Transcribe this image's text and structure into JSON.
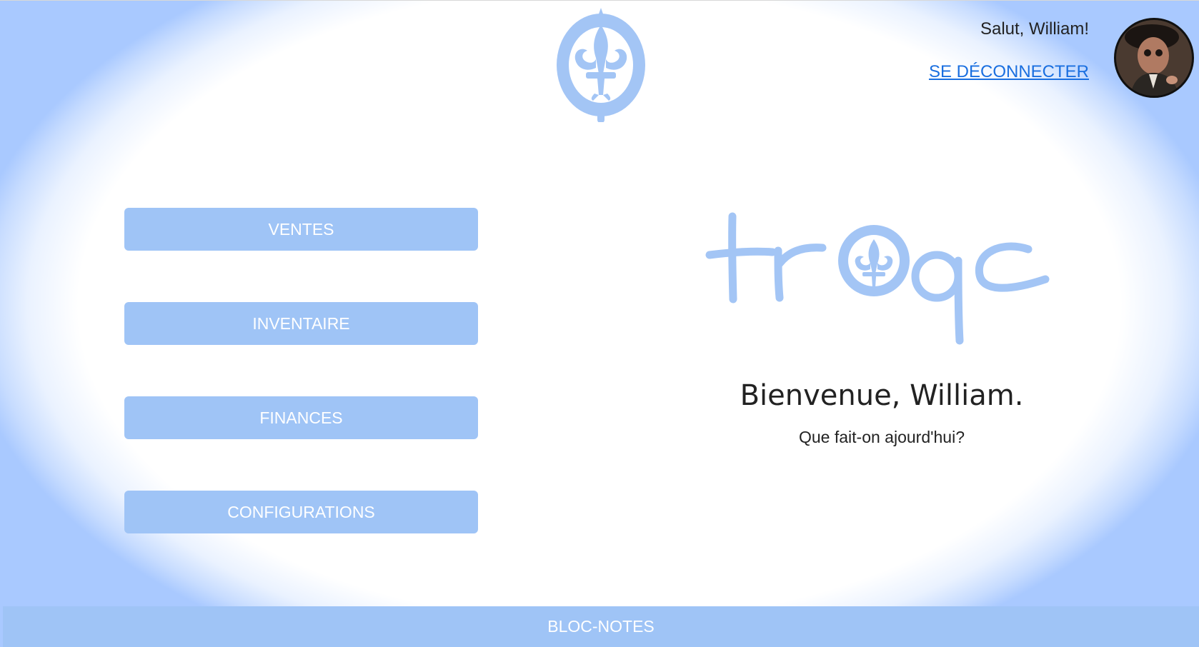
{
  "header": {
    "greeting": "Salut, William!",
    "logout_label": "SE DÉCONNECTER"
  },
  "menu": {
    "ventes": "VENTES",
    "inventaire": "INVENTAIRE",
    "finances": "FINANCES",
    "configurations": "CONFIGURATIONS"
  },
  "brand": {
    "logo_text": "troqc",
    "accent_color": "#9fc4f6"
  },
  "main": {
    "welcome_title": "Bienvenue, William.",
    "welcome_subtitle": "Que fait-on ajourd'hui?"
  },
  "footer": {
    "notes_label": "BLOC-NOTES"
  },
  "icons": {
    "top_logo": "fleur-de-lis-emblem-icon",
    "avatar": "user-avatar"
  }
}
